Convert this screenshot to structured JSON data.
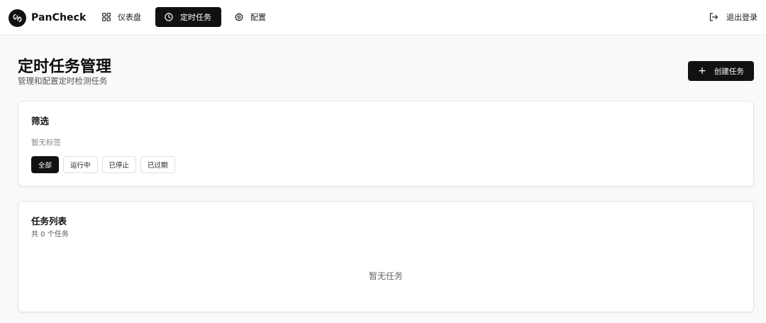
{
  "app": {
    "name": "PanCheck"
  },
  "nav": {
    "items": [
      {
        "label": "仪表盘",
        "icon": "dashboard-icon",
        "active": false
      },
      {
        "label": "定时任务",
        "icon": "clock-icon",
        "active": true
      },
      {
        "label": "配置",
        "icon": "gear-icon",
        "active": false
      }
    ],
    "logout_label": "退出登录"
  },
  "header": {
    "title": "定时任务管理",
    "subtitle": "管理和配置定时检测任务",
    "create_button_label": "创建任务"
  },
  "filter": {
    "title": "筛选",
    "no_tags_text": "暂无标签",
    "chips": [
      {
        "label": "全部",
        "active": true
      },
      {
        "label": "运行中",
        "active": false
      },
      {
        "label": "已停止",
        "active": false
      },
      {
        "label": "已过期",
        "active": false
      }
    ]
  },
  "task_list": {
    "title": "任务列表",
    "count_text": "共 0 个任务",
    "empty_text": "暂无任务"
  },
  "colors": {
    "accent": "#111111",
    "background": "#f9f9f9",
    "card": "#ffffff"
  }
}
